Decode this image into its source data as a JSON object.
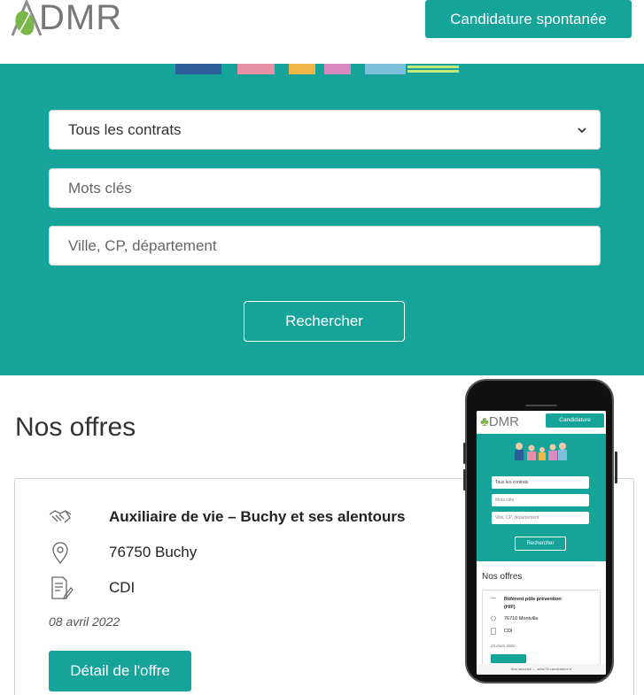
{
  "header": {
    "logo_text": "DMR",
    "cta_label": "Candidature spontanée"
  },
  "search": {
    "contract_selected": "Tous les contrats",
    "keywords_placeholder": "Mots clés",
    "location_placeholder": "Ville, CP, département",
    "submit_label": "Rechercher"
  },
  "offers": {
    "section_title": "Nos offres",
    "items": [
      {
        "title": "Auxiliaire de vie – Buchy et ses alentours",
        "location": "76750 Buchy",
        "contract": "CDI",
        "date": "08 avril 2022",
        "detail_label": "Détail de l'offre"
      }
    ]
  },
  "phone_preview": {
    "logo_text": "DMR",
    "cta_label": "Candidature spontanée",
    "contract_selected": "Tous les contrats",
    "keywords_placeholder": "Mots clés",
    "location_placeholder": "Ville, CP, département",
    "submit_label": "Rechercher",
    "section_title": "Nos offres",
    "offer_title_line1": "Référent pôle prévention",
    "offer_title_line2": "(H/F)",
    "offer_location": "76710 Montville",
    "offer_contract": "CDI",
    "offer_date": "23 mars 2022",
    "footer_text": "Non sécurisé — admr76.candidature.fr"
  },
  "colors": {
    "brand_teal": "#16a39a",
    "logo_green": "#7ab648"
  }
}
